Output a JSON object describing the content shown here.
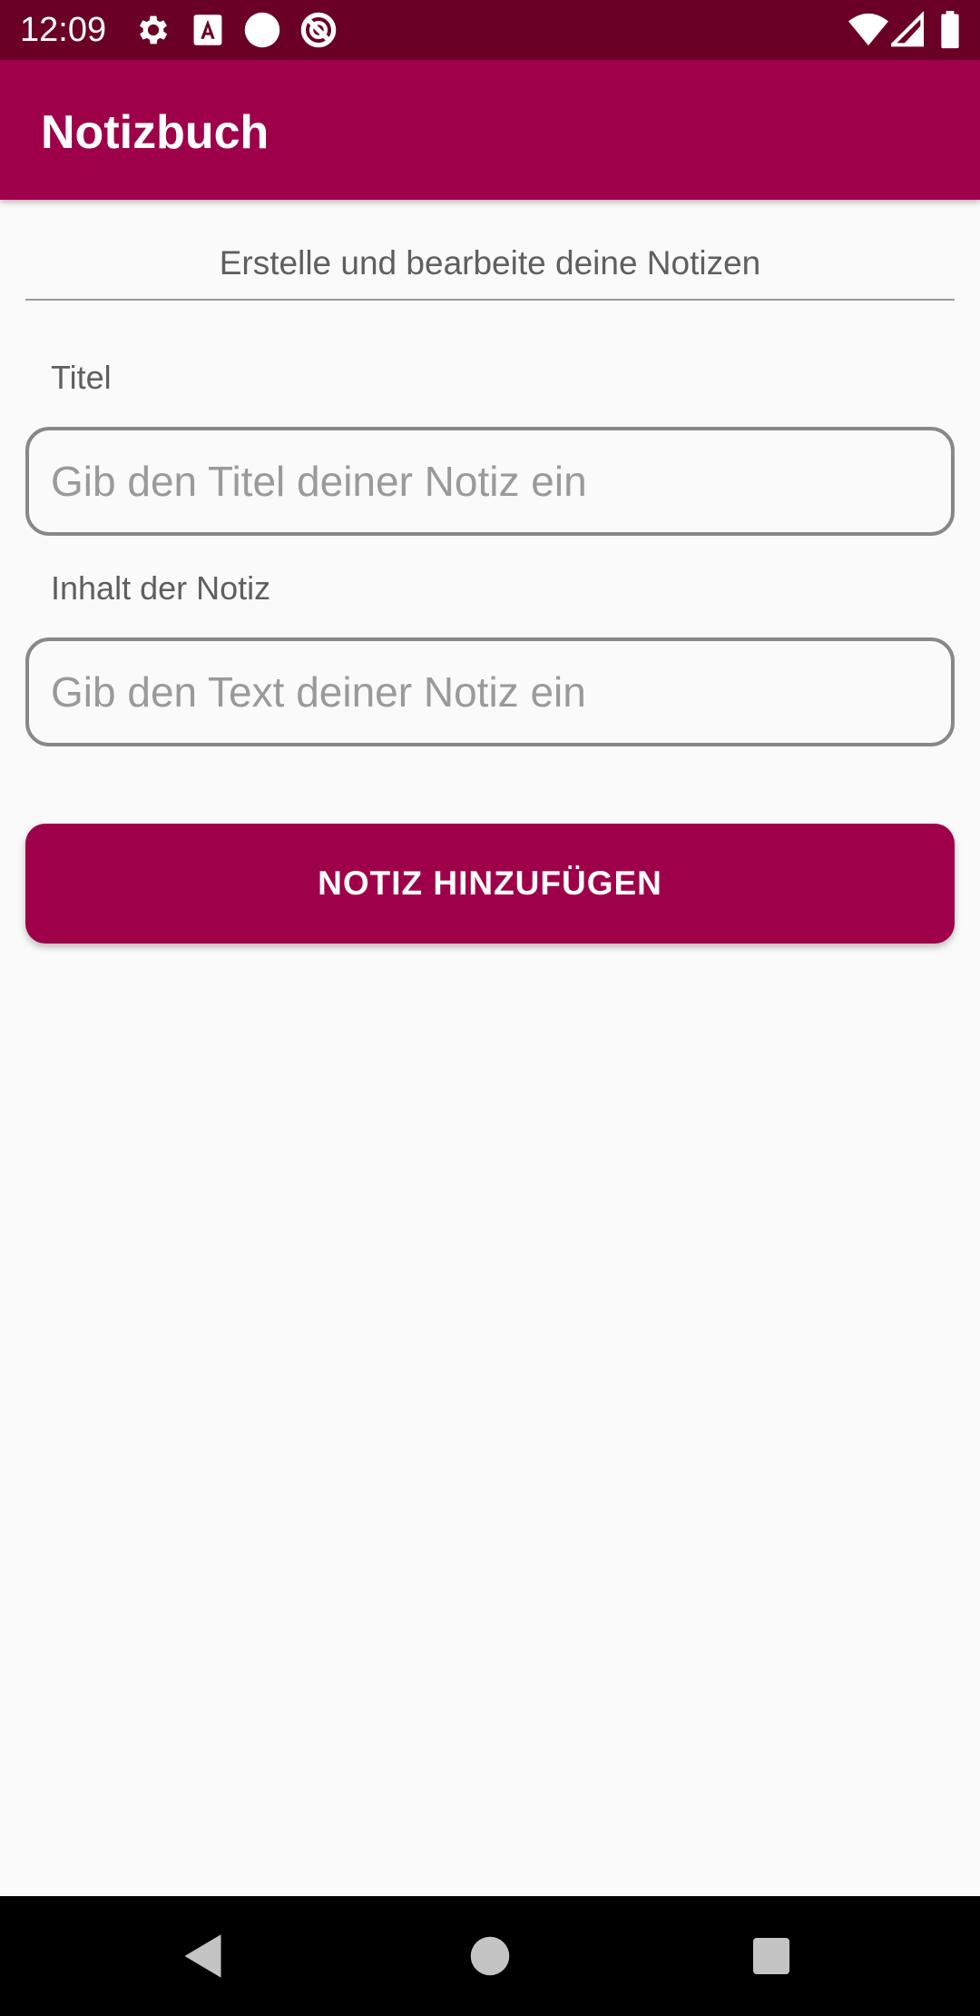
{
  "status_bar": {
    "time": "12:09",
    "icons_left": [
      "gear-icon",
      "keyboard-a-icon",
      "circle-icon",
      "no-disturb-icon"
    ],
    "icons_right": [
      "wifi-icon",
      "signal-icon",
      "battery-icon"
    ],
    "background": "#6b0026"
  },
  "app_bar": {
    "title": "Notizbuch",
    "background": "#9e0049"
  },
  "main": {
    "subtitle": "Erstelle und bearbeite deine Notizen",
    "title_field": {
      "label": "Titel",
      "value": "",
      "placeholder": "Gib den Titel deiner Notiz ein"
    },
    "content_field": {
      "label": "Inhalt der Notiz",
      "value": "",
      "placeholder": "Gib den Text deiner Notiz ein"
    },
    "add_button": {
      "label": "NOTIZ HINZUFÜGEN",
      "color": "#9e0049"
    }
  },
  "nav_bar": {
    "buttons": [
      "back-icon",
      "home-icon",
      "recents-icon"
    ]
  }
}
